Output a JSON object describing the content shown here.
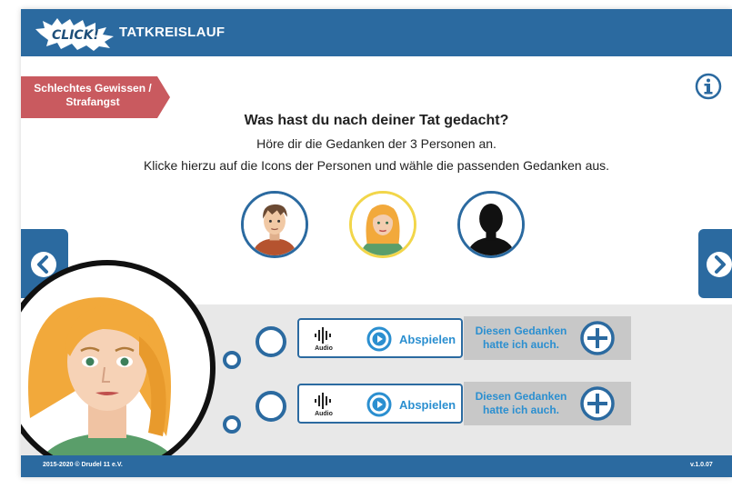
{
  "header": {
    "logo_text": "CLICK!",
    "title": "TATKREISLAUF"
  },
  "category_tag": {
    "line1": "Schlechtes Gewissen /",
    "line2": "Strafangst"
  },
  "prompt": {
    "question": "Was hast du nach deiner Tat gedacht?",
    "line1": "Höre dir die Gedanken der 3 Personen an.",
    "line2": "Klicke hierzu auf die Icons der Personen und wähle die passenden Gedanken aus."
  },
  "persons": [
    {
      "icon": "boy-avatar-icon",
      "selected": false
    },
    {
      "icon": "girl-avatar-icon",
      "selected": true
    },
    {
      "icon": "silhouette-avatar-icon",
      "selected": false
    }
  ],
  "thoughts": [
    {
      "audio_label": "Audio",
      "play_label": "Abspielen",
      "agree_label": "Diesen Gedanken hatte ich auch."
    },
    {
      "audio_label": "Audio",
      "play_label": "Abspielen",
      "agree_label": "Diesen Gedanken hatte ich auch."
    }
  ],
  "footer": {
    "copyright": "2015-2020 © Drudel 11 e.V.",
    "version": "v.1.0.07"
  },
  "colors": {
    "primary": "#2b6aa0",
    "accent_text": "#2b8fd0",
    "tag": "#c95a5f",
    "selected_ring": "#f2d64a",
    "panel": "#e8e8e8"
  }
}
